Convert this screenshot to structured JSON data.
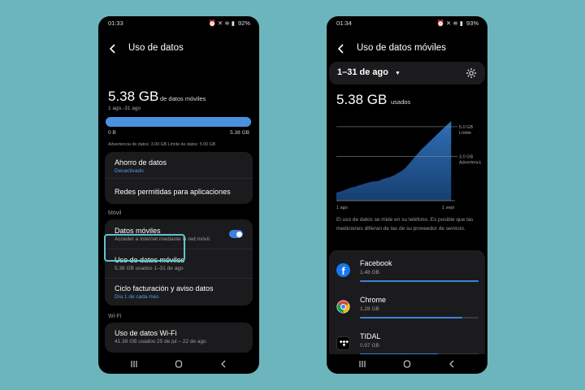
{
  "phone1": {
    "status": {
      "time": "01:33",
      "battery": "92%"
    },
    "title": "Uso de datos",
    "total": {
      "value": "5.38 GB",
      "unit": "de datos móviles",
      "period": "1 ago.-31 ago"
    },
    "bar": {
      "min": "0 B",
      "max": "5.38 GB",
      "fill": 1.0
    },
    "warning_text": "Advertencia de datos: 3.00 GB  Límite de datos: 5.00 GB",
    "saver": {
      "title": "Ahorro de datos",
      "sub": "Desactivado"
    },
    "allowed_networks": "Redes permitidas para aplicaciones",
    "mobile_section": "Móvil",
    "mobile_data": {
      "title": "Datos móviles",
      "sub": "Acceder a Internet mediante la red móvil.",
      "enabled": true
    },
    "mobile_usage": {
      "title": "Uso de datos móviles",
      "sub": "5.38 GB usados 1–31 de ago"
    },
    "billing": {
      "title": "Ciclo facturación y aviso datos",
      "sub": "Día 1 de cada mes"
    },
    "wifi_section": "Wi-Fi",
    "wifi_usage": {
      "title": "Uso de datos Wi-Fi",
      "sub": "41.38 GB usados 25 de jul – 22 de ago"
    }
  },
  "phone2": {
    "status": {
      "time": "01:34",
      "battery": "93%"
    },
    "title": "Uso de datos móviles",
    "period_selector": "1–31 de ago",
    "total": {
      "value": "5.38 GB",
      "unit": "usados"
    },
    "chart_data": {
      "type": "area",
      "x_labels": [
        "1 ago",
        "1 sept"
      ],
      "ylim": [
        0,
        5.38
      ],
      "y_reference_lines": [
        {
          "value": 5.0,
          "label": "5.0 GB",
          "sublabel": "Límite"
        },
        {
          "value": 3.0,
          "label": "3.0 GB",
          "sublabel": "Advertencia"
        }
      ],
      "x": [
        1,
        2,
        3,
        4,
        5,
        6,
        7,
        8,
        9,
        10,
        11,
        12,
        13,
        14,
        15,
        16,
        17,
        18,
        19,
        20,
        21,
        22,
        23,
        24,
        25,
        26,
        27,
        28,
        29,
        30,
        31
      ],
      "values": [
        0.55,
        0.62,
        0.7,
        0.8,
        0.9,
        0.95,
        1.05,
        1.12,
        1.2,
        1.28,
        1.3,
        1.33,
        1.45,
        1.52,
        1.6,
        1.7,
        1.85,
        2.0,
        2.2,
        2.5,
        2.8,
        3.1,
        3.4,
        3.65,
        3.9,
        4.15,
        4.4,
        4.65,
        4.9,
        5.15,
        5.38
      ]
    },
    "disclaimer": "El uso de datos se mide en su teléfono. Es posible que las mediciones difieran de las de su proveedor de servicio.",
    "apps": [
      {
        "name": "Facebook",
        "usage": "1.48 GB",
        "fraction": 1.0,
        "icon": "facebook-icon"
      },
      {
        "name": "Chrome",
        "usage": "1.28 GB",
        "fraction": 0.86,
        "icon": "chrome-icon"
      },
      {
        "name": "TIDAL",
        "usage": "0.97 GB",
        "fraction": 0.66,
        "icon": "tidal-icon"
      }
    ]
  },
  "colors": {
    "accent": "#3c83d9",
    "link": "#4a9ef2",
    "highlight": "#5fc4cf",
    "background": "#6db5bd"
  }
}
